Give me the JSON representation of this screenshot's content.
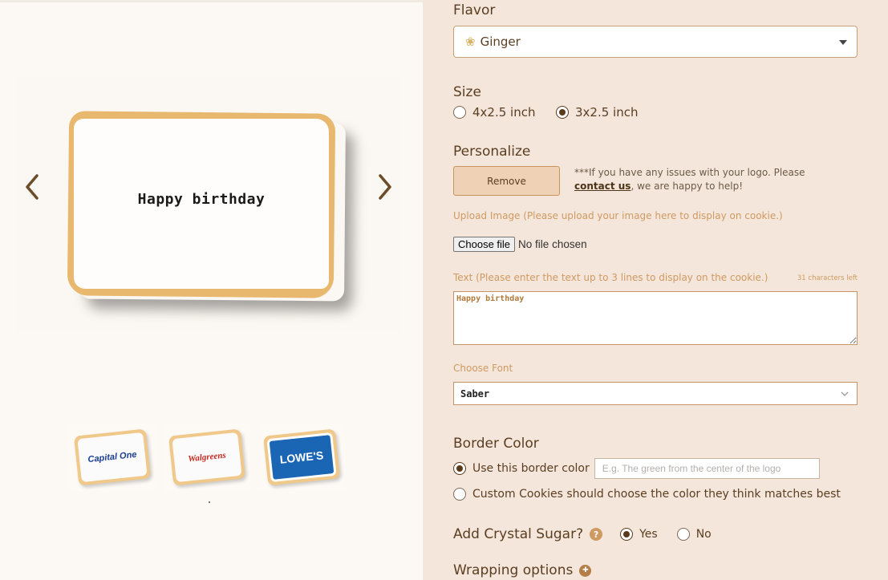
{
  "gallery": {
    "cookie_text": "Happy birthday",
    "thumbnails": [
      {
        "brand": "Capital One",
        "color": "#1b3f8f"
      },
      {
        "brand": "Walgreens",
        "color": "#c8281e"
      },
      {
        "brand": "LOWE'S",
        "color": "#0a5aa8"
      }
    ]
  },
  "flavor": {
    "title": "Flavor",
    "selected": "Ginger",
    "icon": "ginger-icon"
  },
  "size": {
    "title": "Size",
    "options": [
      "4x2.5 inch",
      "3x2.5 inch"
    ],
    "selected": "3x2.5 inch"
  },
  "personalize": {
    "title": "Personalize",
    "remove_label": "Remove",
    "note_prefix": "***If you have any issues with your logo. Please",
    "note_link": "contact us",
    "note_suffix": ", we are happy to help!",
    "upload_label": "Upload Image (Please upload your image here to display on cookie.)",
    "choose_file": "Choose file",
    "no_file": "No file chosen",
    "text_label": "Text (Please enter the text up to 3 lines to display on the cookie.)",
    "chars_left": "31 characters left",
    "text_value": "Happy birthday",
    "font_label": "Choose Font",
    "font_selected": "Saber"
  },
  "border": {
    "title": "Border Color",
    "option1": "Use this border color",
    "placeholder": "E.g. The green from the center of the logo",
    "option2": "Custom Cookies should choose the color they think matches best"
  },
  "crystal": {
    "title": "Add Crystal Sugar?",
    "yes": "Yes",
    "no": "No"
  },
  "wrapping": {
    "title": "Wrapping options"
  },
  "colors": {
    "accent": "#cf9a62",
    "brown": "#5b3e22",
    "panel": "#f4e6da"
  }
}
